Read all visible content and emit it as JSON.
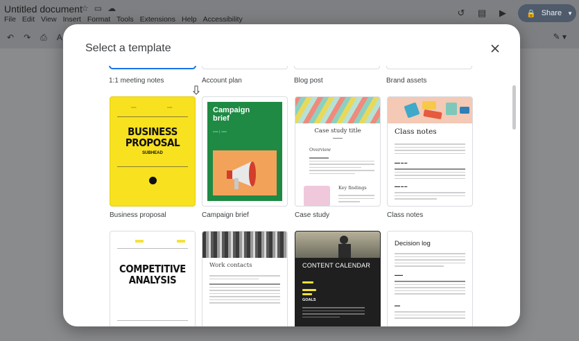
{
  "app": {
    "doc_title": "Untitled document",
    "menu": [
      "File",
      "Edit",
      "View",
      "Insert",
      "Format",
      "Tools",
      "Extensions",
      "Help",
      "Accessibility"
    ],
    "share_label": "Share"
  },
  "modal": {
    "title": "Select a template",
    "close_icon": "close-icon"
  },
  "templates": {
    "row1": [
      "1:1 meeting notes",
      "Account plan",
      "Blog post",
      "Brand assets"
    ],
    "row2": [
      "Business proposal",
      "Campaign brief",
      "Case study",
      "Class notes"
    ]
  },
  "thumbs": {
    "business_proposal": {
      "title_line1": "BUSINESS",
      "title_line2": "PROPOSAL",
      "subhead": "SUBHEAD"
    },
    "campaign_brief": {
      "title_line1": "Campaign",
      "title_line2": "brief"
    },
    "case_study": {
      "title": "Case study title",
      "overview": "Overview",
      "key_findings": "Key findings"
    },
    "class_notes": {
      "title": "Class notes"
    },
    "competitive_analysis": {
      "title_line1": "COMPETITIVE",
      "title_line2": "ANALYSIS"
    },
    "work_contacts": {
      "title": "Work contacts"
    },
    "content_calendar": {
      "title": "CONTENT CALENDAR",
      "goals": "GOALS"
    },
    "decision_log": {
      "title": "Decision log"
    }
  },
  "colors": {
    "accent": "#1a73e8",
    "proposal_yellow": "#f8e11f",
    "campaign_green": "#1e8a44",
    "campaign_orange": "#f3a25a"
  }
}
